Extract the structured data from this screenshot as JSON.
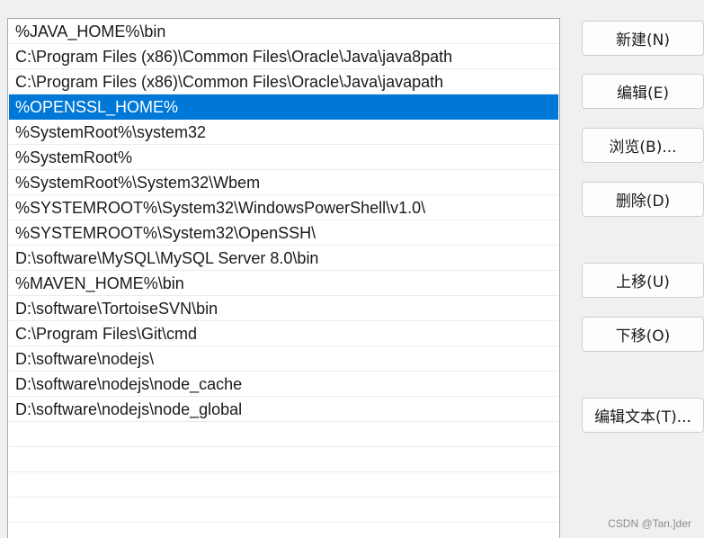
{
  "path_list": {
    "items": [
      "%JAVA_HOME%\\bin",
      "C:\\Program Files (x86)\\Common Files\\Oracle\\Java\\java8path",
      "C:\\Program Files (x86)\\Common Files\\Oracle\\Java\\javapath",
      "%OPENSSL_HOME%",
      "%SystemRoot%\\system32",
      "%SystemRoot%",
      "%SystemRoot%\\System32\\Wbem",
      "%SYSTEMROOT%\\System32\\WindowsPowerShell\\v1.0\\",
      "%SYSTEMROOT%\\System32\\OpenSSH\\",
      "D:\\software\\MySQL\\MySQL Server 8.0\\bin",
      "%MAVEN_HOME%\\bin",
      "D:\\software\\TortoiseSVN\\bin",
      "C:\\Program Files\\Git\\cmd",
      "D:\\software\\nodejs\\",
      "D:\\software\\nodejs\\node_cache",
      "D:\\software\\nodejs\\node_global",
      "",
      "",
      "",
      "",
      ""
    ],
    "selected_item": "%OPENSSL_HOME%",
    "selection_color": "#0078d7"
  },
  "buttons": {
    "new": "新建(N)",
    "edit": "编辑(E)",
    "browse": "浏览(B)...",
    "delete": "删除(D)",
    "move_up": "上移(U)",
    "move_down": "下移(O)",
    "edit_text": "编辑文本(T)..."
  },
  "watermark": "CSDN @Tan.]der"
}
